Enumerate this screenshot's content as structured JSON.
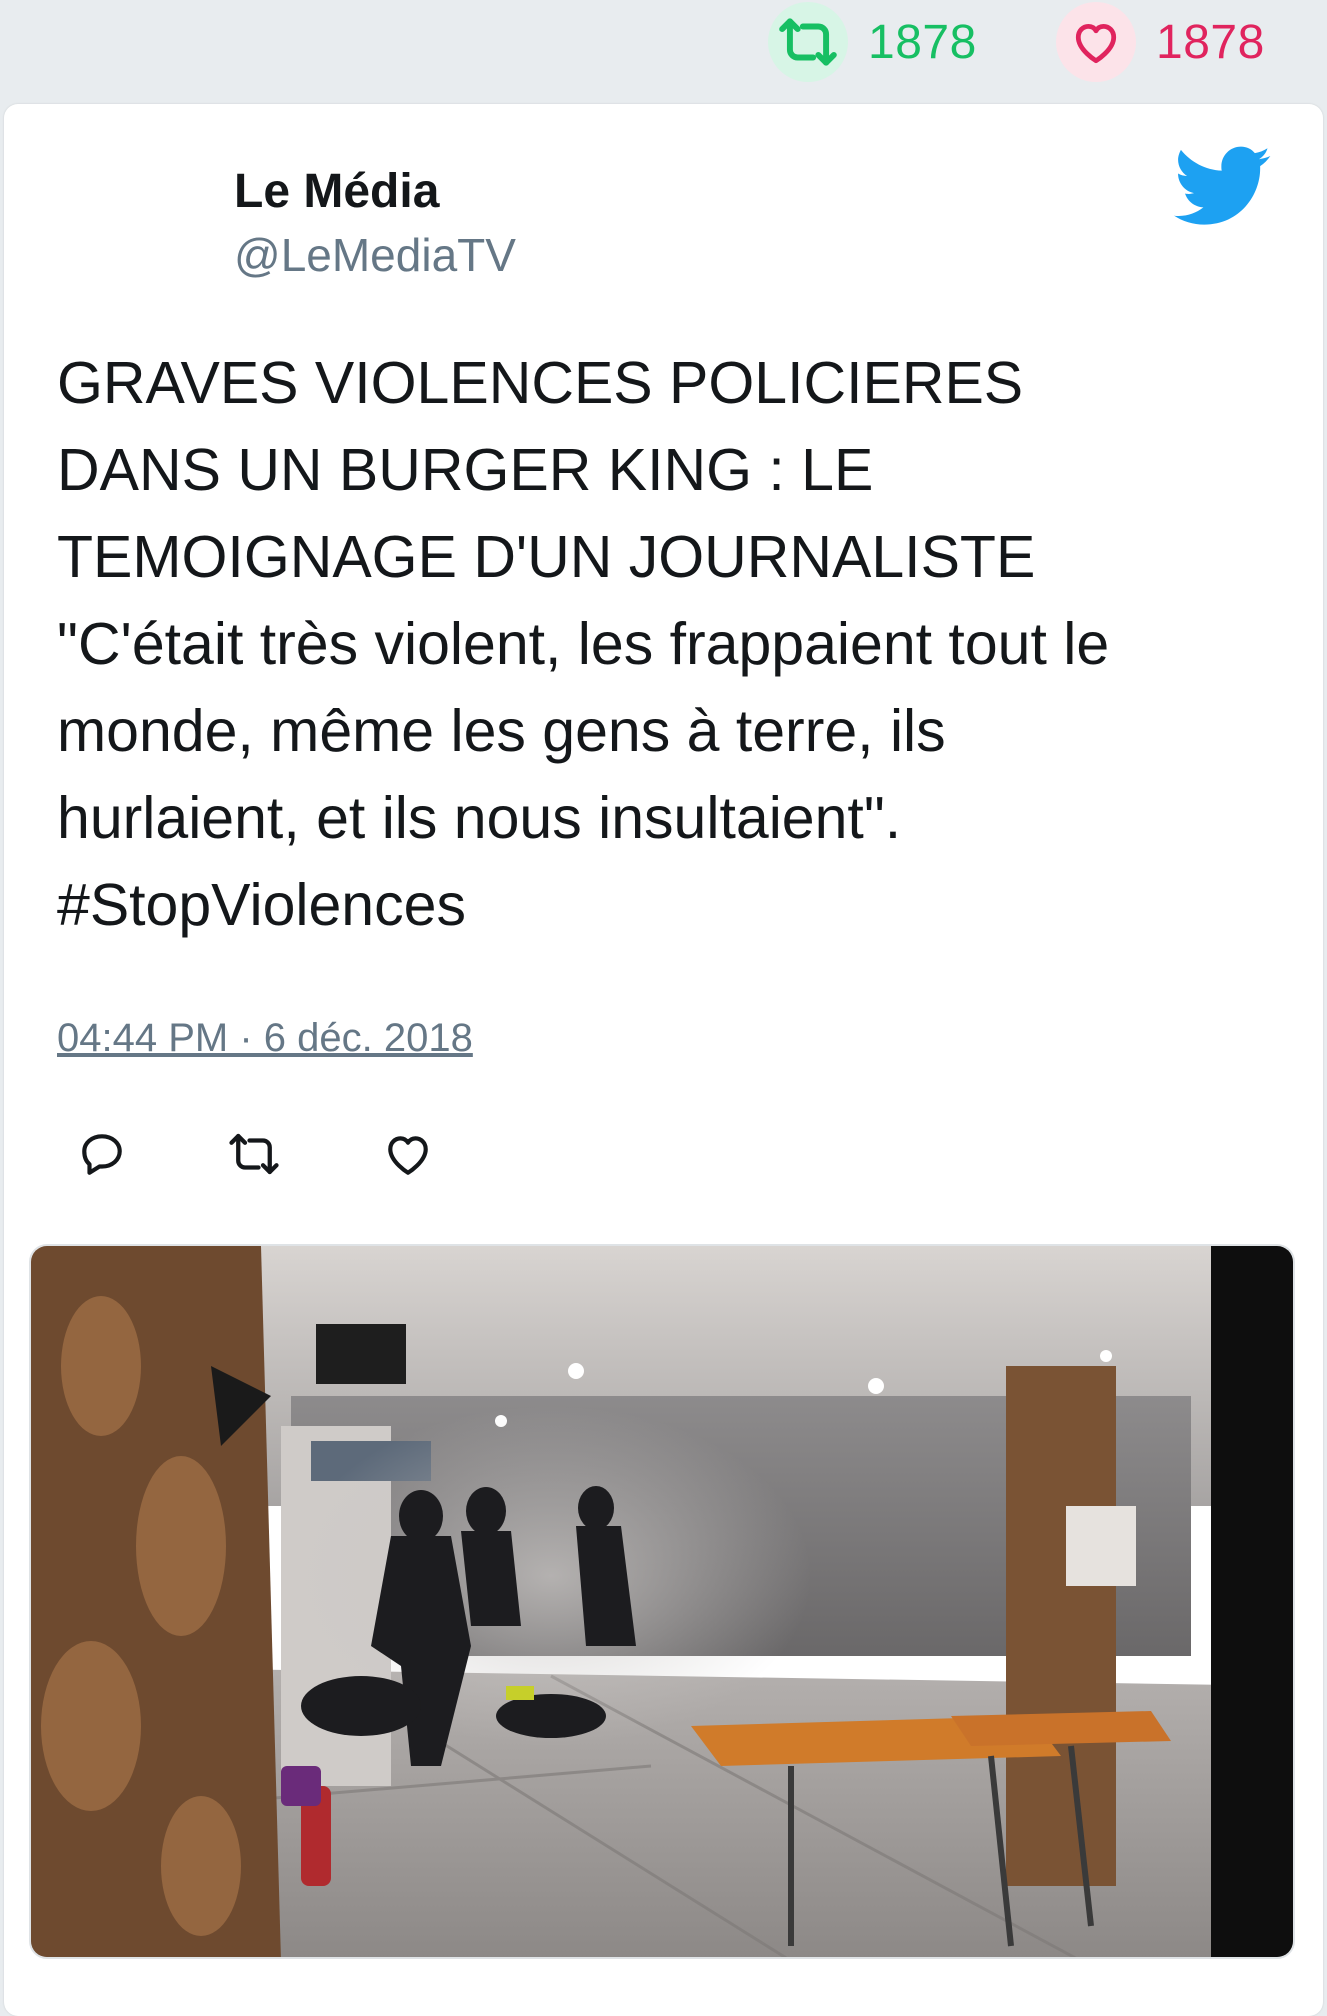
{
  "stats": {
    "retweets": "1878",
    "likes": "1878",
    "retweet_icon": "retweet-icon",
    "like_icon": "heart-icon"
  },
  "tweet": {
    "author_name": "Le Média",
    "author_handle": "@LeMediaTV",
    "text_lines": [
      "GRAVES VIOLENCES POLICIERES",
      "DANS UN BURGER KING : LE",
      "TEMOIGNAGE D'UN JOURNALISTE",
      "\"C'était très violent, les frappaient tout le",
      "monde, même les gens à terre, ils",
      "hurlaient, et ils nous insultaient\".",
      "#StopViolences"
    ],
    "timestamp": "04:44 PM · 6 déc. 2018",
    "actions": [
      "reply-icon",
      "retweet-icon",
      "heart-icon"
    ],
    "logo_icon": "twitter-bird-icon"
  },
  "colors": {
    "retweet_green": "#17bf63",
    "like_red": "#e0245e",
    "twitter_blue": "#1da1f2",
    "text_primary": "#14171a",
    "text_secondary": "#657786"
  }
}
